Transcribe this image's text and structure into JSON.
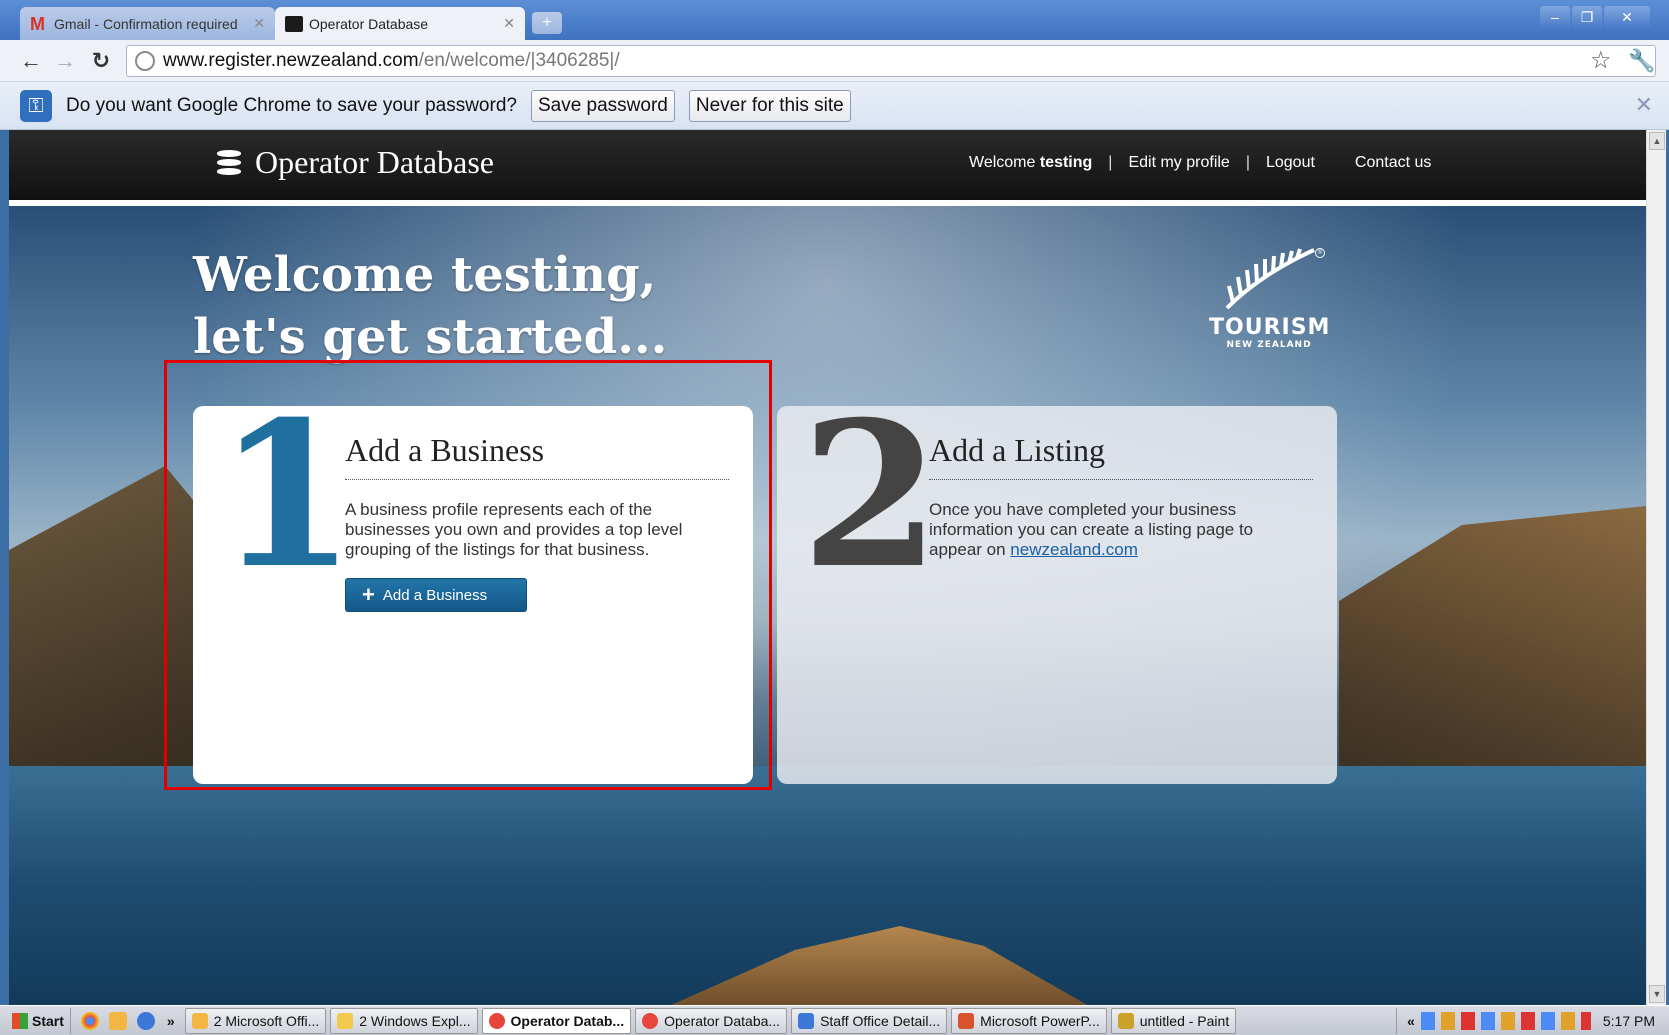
{
  "browser": {
    "tabs": [
      {
        "title": "Gmail - Confirmation required",
        "active": false
      },
      {
        "title": "Operator Database",
        "active": true
      }
    ],
    "url_host": "www.register.newzealand.com",
    "url_path": "/en/welcome/|3406285|/",
    "infobar": {
      "text": "Do you want Google Chrome to save your password?",
      "save_button": "Save password",
      "never_button": "Never for this site"
    }
  },
  "site": {
    "brand": "Operator Database",
    "nav": {
      "welcome_prefix": "Welcome",
      "username": "testing",
      "separator": "|",
      "edit_profile": "Edit my profile",
      "logout": "Logout",
      "contact": "Contact us"
    },
    "hero": {
      "line1": "Welcome testing,",
      "line2": "let's get started..."
    },
    "logo": {
      "main": "TOURISM",
      "sub": "NEW ZEALAND",
      "reg": "®"
    },
    "cards": [
      {
        "number": "1",
        "title": "Add a Business",
        "text": "A business profile represents each of the businesses you own and provides a top level grouping of the listings for that business.",
        "button": "Add a Business"
      },
      {
        "number": "2",
        "title": "Add a Listing",
        "text": "Once you have completed your business information you can create a listing page to appear on ",
        "link": "newzealand.com"
      }
    ]
  },
  "taskbar": {
    "start": "Start",
    "more": "»",
    "tasks": [
      {
        "label": "2 Microsoft Offi...",
        "active": false
      },
      {
        "label": "2 Windows Expl...",
        "active": false
      },
      {
        "label": "Operator Datab...",
        "active": true
      },
      {
        "label": "Operator Databa...",
        "active": false
      },
      {
        "label": "Staff Office Detail...",
        "active": false
      },
      {
        "label": "Microsoft PowerP...",
        "active": false
      },
      {
        "label": "untitled - Paint",
        "active": false
      }
    ],
    "tray_chevron": "«",
    "clock": "5:17 PM"
  },
  "colors": {
    "accent_blue": "#1f6f9f",
    "highlight_red": "#e00000",
    "header_black": "#111111"
  }
}
